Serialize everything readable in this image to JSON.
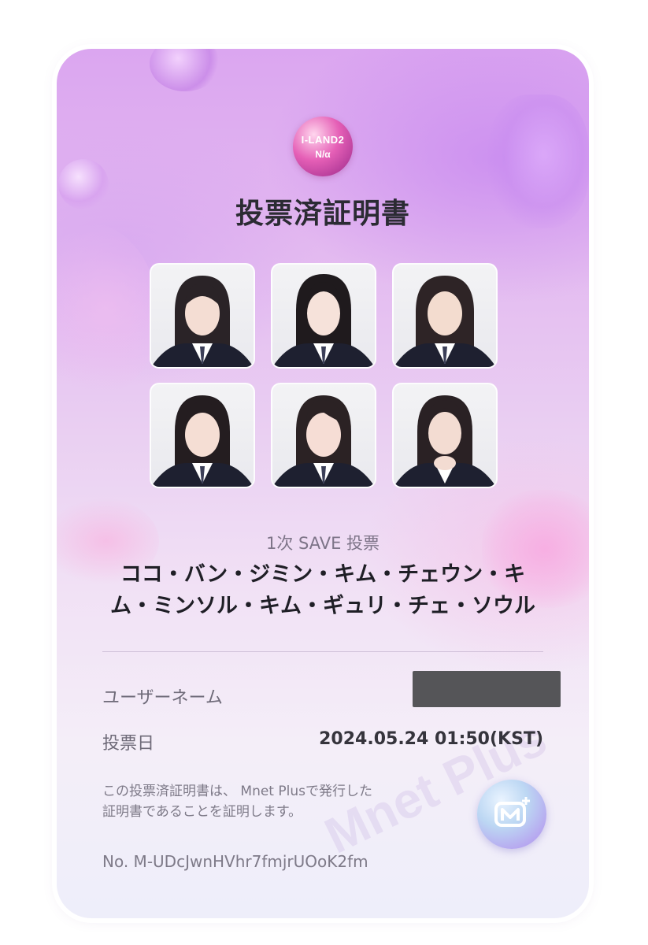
{
  "logo": {
    "main": "I-LAND2",
    "sub": "N/α"
  },
  "title": "投票済証明書",
  "photos": [
    {
      "name": "photo-1"
    },
    {
      "name": "photo-2"
    },
    {
      "name": "photo-3"
    },
    {
      "name": "photo-4"
    },
    {
      "name": "photo-5"
    },
    {
      "name": "photo-6"
    }
  ],
  "vote_round": "1次 SAVE  投票",
  "members_line1": "ココ・バン・ジミン・キム・チェウン・キ",
  "members_line2": "ム・ミンソル・キム・ギュリ・チェ・ソウル",
  "username_label": "ユーザーネーム",
  "vote_date_label": "投票日",
  "vote_date_value": "2024.05.24 01:50(KST)",
  "notice_line1": "この投票済証明書は、 Mnet Plusで発行した",
  "notice_line2": "証明書であることを証明します。",
  "serial": "No. M-UDcJwnHVhr7fmjrUOoK2fm",
  "watermark": "Mnet Plus",
  "badge_icon": "mnet-plus-icon",
  "colors": {
    "title": "#2b2b33",
    "card_top": "#dba6f0",
    "card_bottom": "#eeeefa",
    "redaction": "#555558"
  }
}
